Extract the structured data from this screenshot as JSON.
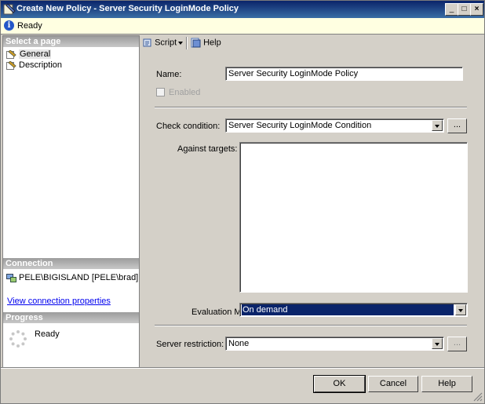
{
  "window": {
    "title": "Create New Policy - Server Security LoginMode Policy"
  },
  "status": {
    "text": "Ready"
  },
  "left": {
    "select_page_header": "Select a page",
    "pages": [
      "General",
      "Description"
    ],
    "connection_header": "Connection",
    "connection_text": "PELE\\BIGISLAND [PELE\\brad]",
    "view_connection_link": "View connection properties",
    "progress_header": "Progress",
    "progress_text": "Ready"
  },
  "toolbar": {
    "script_label": "Script",
    "help_label": "Help"
  },
  "form": {
    "name_label": "Name:",
    "name_value": "Server Security LoginMode Policy",
    "enabled_label": "Enabled",
    "check_condition_label": "Check condition:",
    "check_condition_value": "Server Security LoginMode Condition",
    "against_targets_label": "Against targets:",
    "evaluation_mode_label": "Evaluation Mode:",
    "evaluation_mode_value": "On demand",
    "server_restriction_label": "Server restriction:",
    "server_restriction_value": "None",
    "ellipsis": "..."
  },
  "buttons": {
    "ok": "OK",
    "cancel": "Cancel",
    "help": "Help"
  },
  "colors": {
    "title_bar": "#0a246a",
    "selection": "#0a246a",
    "status_bg": "#ffffe1"
  }
}
